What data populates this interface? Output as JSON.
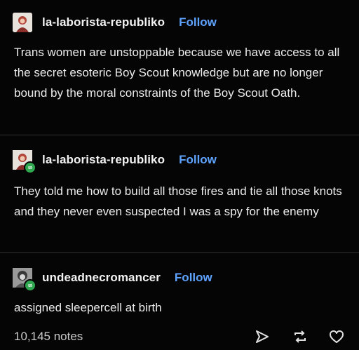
{
  "posts": [
    {
      "username": "la-laborista-republiko",
      "follow_label": "Follow",
      "text": "Trans women are unstoppable because we have access to all the secret esoteric Boy Scout knowledge but are no longer bound by the moral constraints of the Boy Scout Oath.",
      "avatar_icon": "portrait-avatar-icon",
      "reblog": false
    },
    {
      "username": "la-laborista-republiko",
      "follow_label": "Follow",
      "text": "They told me how to build all those fires and tie all those knots and they never even suspected I was a spy for the enemy",
      "avatar_icon": "portrait-avatar-icon",
      "reblog": true
    },
    {
      "username": "undeadnecromancer",
      "follow_label": "Follow",
      "text": "assigned sleepercell at birth",
      "avatar_icon": "portrait-avatar-icon",
      "reblog": true
    }
  ],
  "footer": {
    "notes": "10,145 notes",
    "icons": [
      "share-icon",
      "reblog-icon",
      "like-heart-icon"
    ]
  },
  "colors": {
    "background": "#050505",
    "follow": "#5ea3ff",
    "reblog_badge": "#2fa84f",
    "text": "#ececec"
  }
}
